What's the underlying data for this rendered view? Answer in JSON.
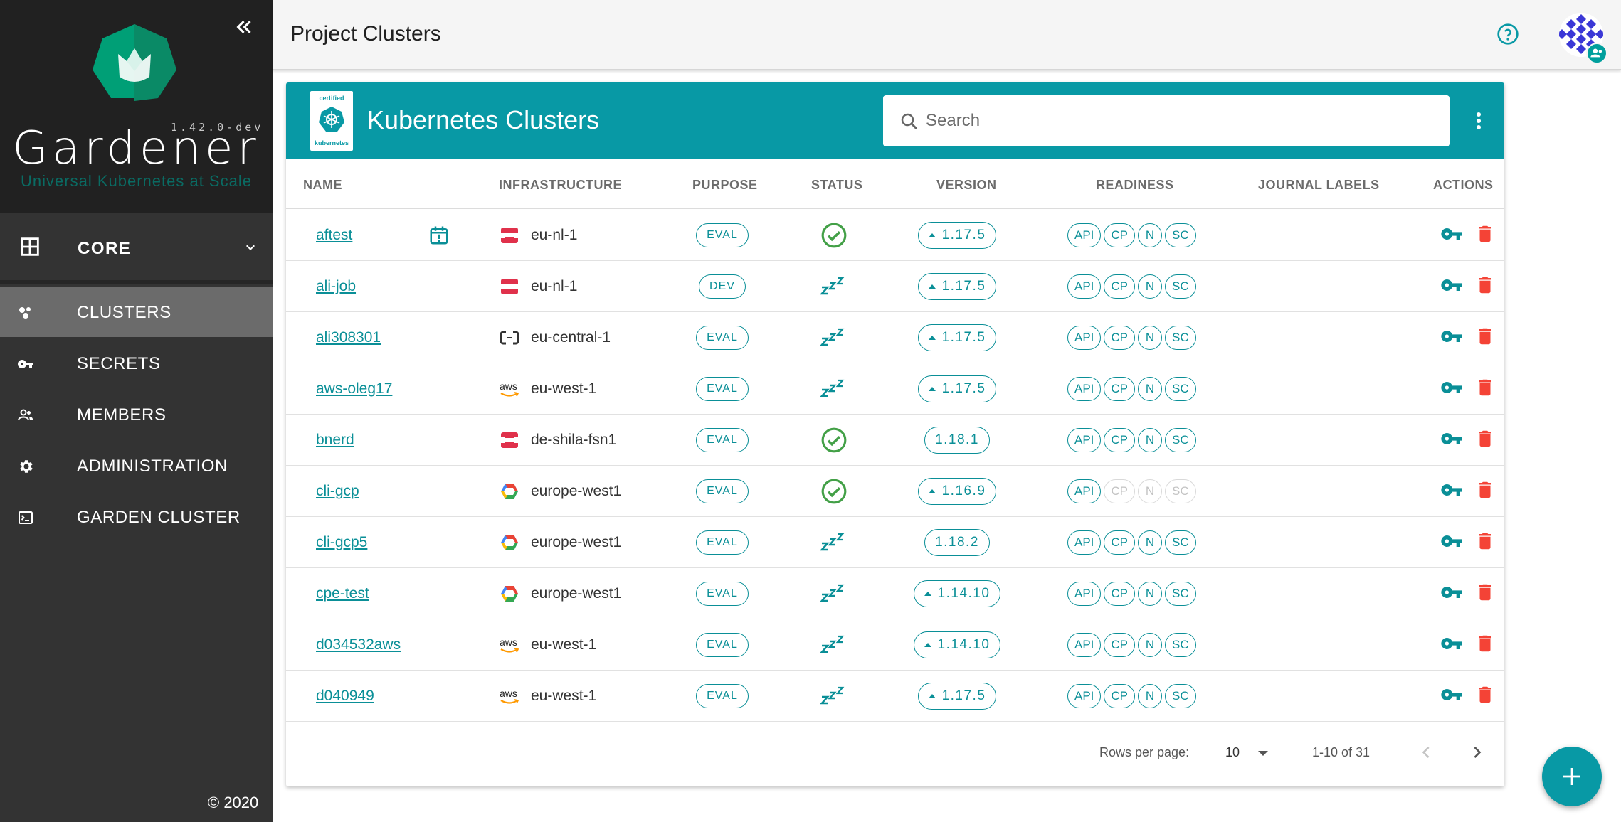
{
  "sidebar": {
    "brand": {
      "version": "1.42.0-dev",
      "name": "Gardener",
      "tagline": "Universal Kubernetes at Scale"
    },
    "section": "CORE",
    "items": [
      {
        "label": "CLUSTERS",
        "icon": "clusters-icon",
        "active": true
      },
      {
        "label": "SECRETS",
        "icon": "key-icon",
        "active": false
      },
      {
        "label": "MEMBERS",
        "icon": "members-icon",
        "active": false
      },
      {
        "label": "ADMINISTRATION",
        "icon": "gear-icon",
        "active": false
      },
      {
        "label": "GARDEN CLUSTER",
        "icon": "terminal-icon",
        "active": false
      }
    ],
    "copyright": "© 2020"
  },
  "topbar": {
    "title": "Project Clusters"
  },
  "card": {
    "title": "Kubernetes Clusters",
    "badge_top": "certified",
    "badge_bottom": "kubernetes",
    "search_placeholder": "Search"
  },
  "table": {
    "headers": {
      "name": "NAME",
      "infrastructure": "INFRASTRUCTURE",
      "purpose": "PURPOSE",
      "status": "STATUS",
      "version": "VERSION",
      "readiness": "READINESS",
      "journal": "JOURNAL LABELS",
      "actions": "ACTIONS"
    },
    "rows": [
      {
        "name": "aftest",
        "infra": "openstack",
        "region": "eu-nl-1",
        "purpose": "EVAL",
        "status": "ok",
        "version": "1.17.5",
        "upgrade": true,
        "readiness": [
          "on",
          "on",
          "on",
          "on"
        ],
        "schedule": true
      },
      {
        "name": "ali-job",
        "infra": "openstack",
        "region": "eu-nl-1",
        "purpose": "DEV",
        "status": "sleep",
        "version": "1.17.5",
        "upgrade": true,
        "readiness": [
          "on",
          "on",
          "on",
          "on"
        ],
        "schedule": false
      },
      {
        "name": "ali308301",
        "infra": "alicloud",
        "region": "eu-central-1",
        "purpose": "EVAL",
        "status": "sleep",
        "version": "1.17.5",
        "upgrade": true,
        "readiness": [
          "on",
          "on",
          "on",
          "on"
        ],
        "schedule": false
      },
      {
        "name": "aws-oleg17",
        "infra": "aws",
        "region": "eu-west-1",
        "purpose": "EVAL",
        "status": "sleep",
        "version": "1.17.5",
        "upgrade": true,
        "readiness": [
          "on",
          "on",
          "on",
          "on"
        ],
        "schedule": false
      },
      {
        "name": "bnerd",
        "infra": "openstack",
        "region": "de-shila-fsn1",
        "purpose": "EVAL",
        "status": "ok",
        "version": "1.18.1",
        "upgrade": false,
        "readiness": [
          "on",
          "on",
          "on",
          "on"
        ],
        "schedule": false
      },
      {
        "name": "cli-gcp",
        "infra": "gcp",
        "region": "europe-west1",
        "purpose": "EVAL",
        "status": "ok",
        "version": "1.16.9",
        "upgrade": true,
        "readiness": [
          "on",
          "off",
          "off",
          "off"
        ],
        "schedule": false
      },
      {
        "name": "cli-gcp5",
        "infra": "gcp",
        "region": "europe-west1",
        "purpose": "EVAL",
        "status": "sleep",
        "version": "1.18.2",
        "upgrade": false,
        "readiness": [
          "on",
          "on",
          "on",
          "on"
        ],
        "schedule": false
      },
      {
        "name": "cpe-test",
        "infra": "gcp",
        "region": "europe-west1",
        "purpose": "EVAL",
        "status": "sleep",
        "version": "1.14.10",
        "upgrade": true,
        "readiness": [
          "on",
          "on",
          "on",
          "on"
        ],
        "schedule": false
      },
      {
        "name": "d034532aws",
        "infra": "aws",
        "region": "eu-west-1",
        "purpose": "EVAL",
        "status": "sleep",
        "version": "1.14.10",
        "upgrade": true,
        "readiness": [
          "on",
          "on",
          "on",
          "on"
        ],
        "schedule": false
      },
      {
        "name": "d040949",
        "infra": "aws",
        "region": "eu-west-1",
        "purpose": "EVAL",
        "status": "sleep",
        "version": "1.17.5",
        "upgrade": true,
        "readiness": [
          "on",
          "on",
          "on",
          "on"
        ],
        "schedule": false
      }
    ],
    "readiness_labels": [
      "API",
      "CP",
      "N",
      "SC"
    ],
    "aws_label": "aws"
  },
  "pagination": {
    "rows_per_page_label": "Rows per page:",
    "rows_per_page": "10",
    "range": "1-10 of 31"
  },
  "colors": {
    "accent": "#0899a5",
    "link": "#0a8f97",
    "success": "#43a047",
    "danger": "#f44336",
    "sidebar": "#333333",
    "sidebar_active": "#6b6b6b"
  }
}
